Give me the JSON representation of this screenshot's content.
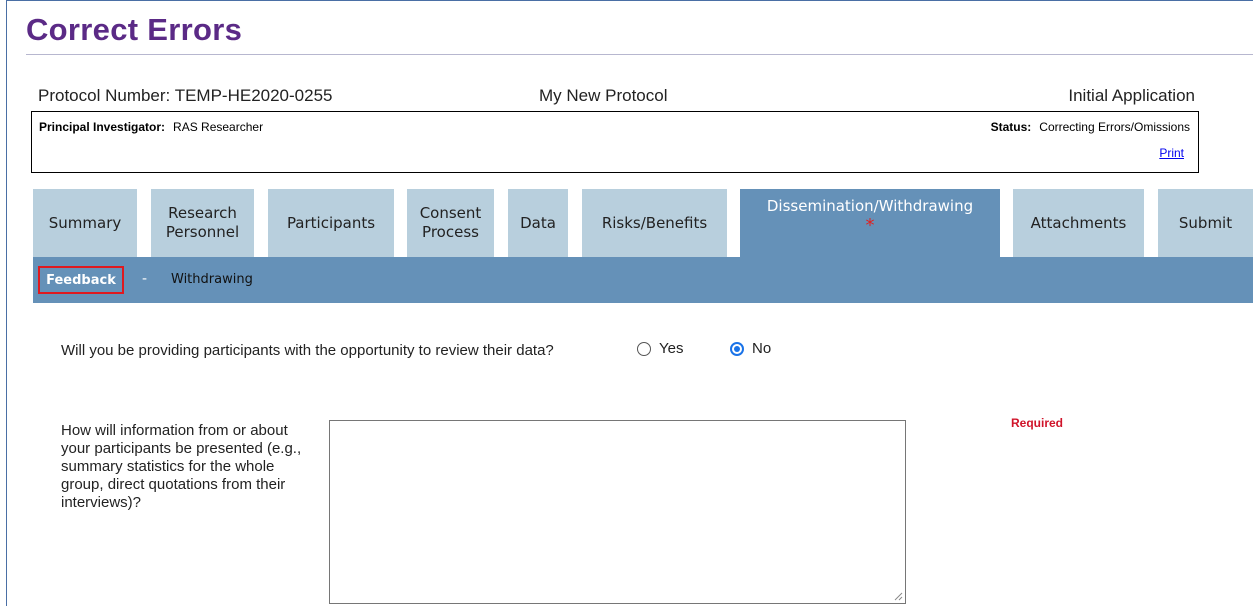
{
  "header": {
    "title": "Correct Errors"
  },
  "protocol": {
    "number_text": "Protocol Number: TEMP-HE2020-0255",
    "name": "My New Protocol",
    "type": "Initial Application",
    "pi_label": "Principal Investigator:",
    "pi_value": "RAS Researcher",
    "status_label": "Status:",
    "status_value": "Correcting Errors/Omissions",
    "print_label": "Print"
  },
  "tabs": [
    {
      "label": "Summary"
    },
    {
      "label": "Research Personnel"
    },
    {
      "label": "Participants"
    },
    {
      "label": "Consent Process"
    },
    {
      "label": "Data"
    },
    {
      "label": "Risks/Benefits"
    },
    {
      "label": "Dissemination/Withdrawing",
      "active": true,
      "required_mark": "*"
    },
    {
      "label": "Attachments"
    },
    {
      "label": "Submit"
    }
  ],
  "subtabs": {
    "feedback": "Feedback",
    "separator": "-",
    "withdrawing": "Withdrawing"
  },
  "form": {
    "q1_label": "Will you be providing participants with the opportunity to review their data?",
    "q1_options": [
      {
        "label": "Yes",
        "selected": false
      },
      {
        "label": "No",
        "selected": true
      }
    ],
    "q2_label": "How will information from or about your participants be presented (e.g., summary statistics for the whole group, direct quotations from their interviews)?",
    "q2_value": "",
    "required_text": "Required"
  },
  "colors": {
    "title": "#5b2a86",
    "tab_inactive": "#b8cfdd",
    "tab_active": "#6591b8",
    "required": "#d0142a",
    "highlight_box": "#e0191f"
  }
}
